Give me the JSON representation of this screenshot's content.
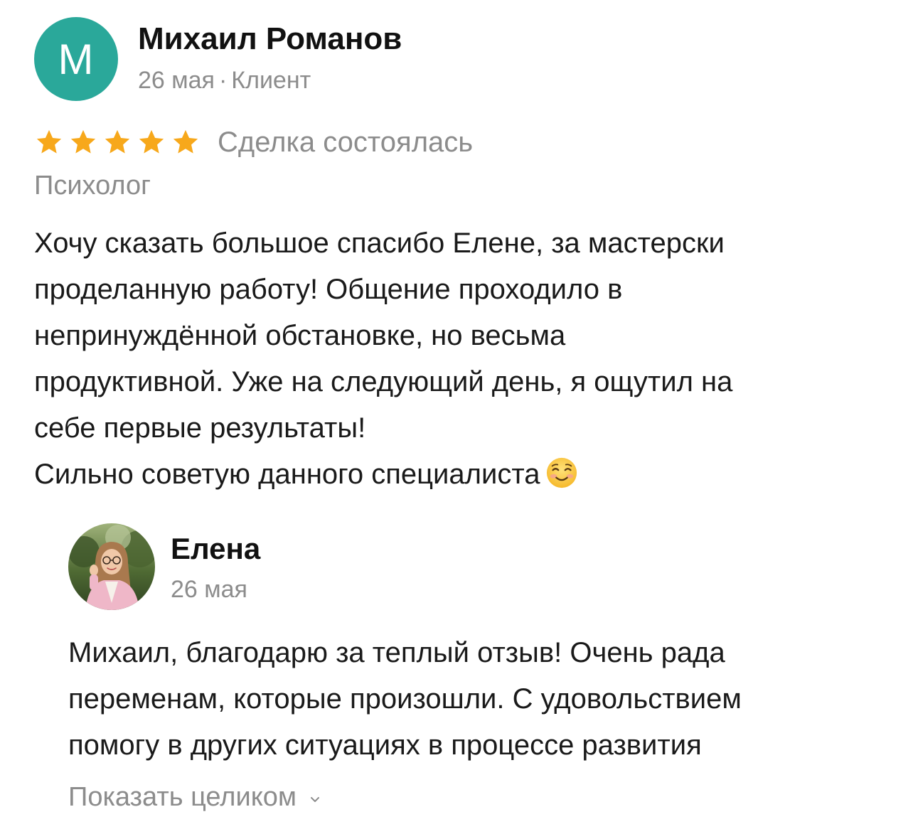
{
  "review": {
    "author": {
      "initial": "М",
      "name": "Михаил Романов",
      "date": "26 мая",
      "separator": "·",
      "role": "Клиент",
      "avatar_color": "#2aa89a"
    },
    "rating": 5,
    "rating_max": 5,
    "star_color": "#f7a81b",
    "deal_status": "Сделка состоялась",
    "service": "Психолог",
    "text_lines": [
      "Хочу сказать большое спасибо Елене, за мастерски",
      "проделанную работу! Общение проходило в",
      "непринуждённой обстановке, но весьма",
      "продуктивной. Уже на следующий день, я ощутил на",
      "себе первые результаты!",
      "Сильно советую данного специалиста"
    ],
    "emoji_icon": "smiling-face-icon"
  },
  "reply": {
    "name": "Елена",
    "date": "26 мая",
    "avatar_icon": "user-photo-avatar",
    "text_lines": [
      "Михаил, благодарю за теплый отзыв! Очень рада",
      "переменам, которые произошли. С удовольствием",
      "помогу в других ситуациях в процессе развития"
    ],
    "show_more_label": "Показать целиком",
    "show_more_icon": "chevron-down-icon"
  }
}
